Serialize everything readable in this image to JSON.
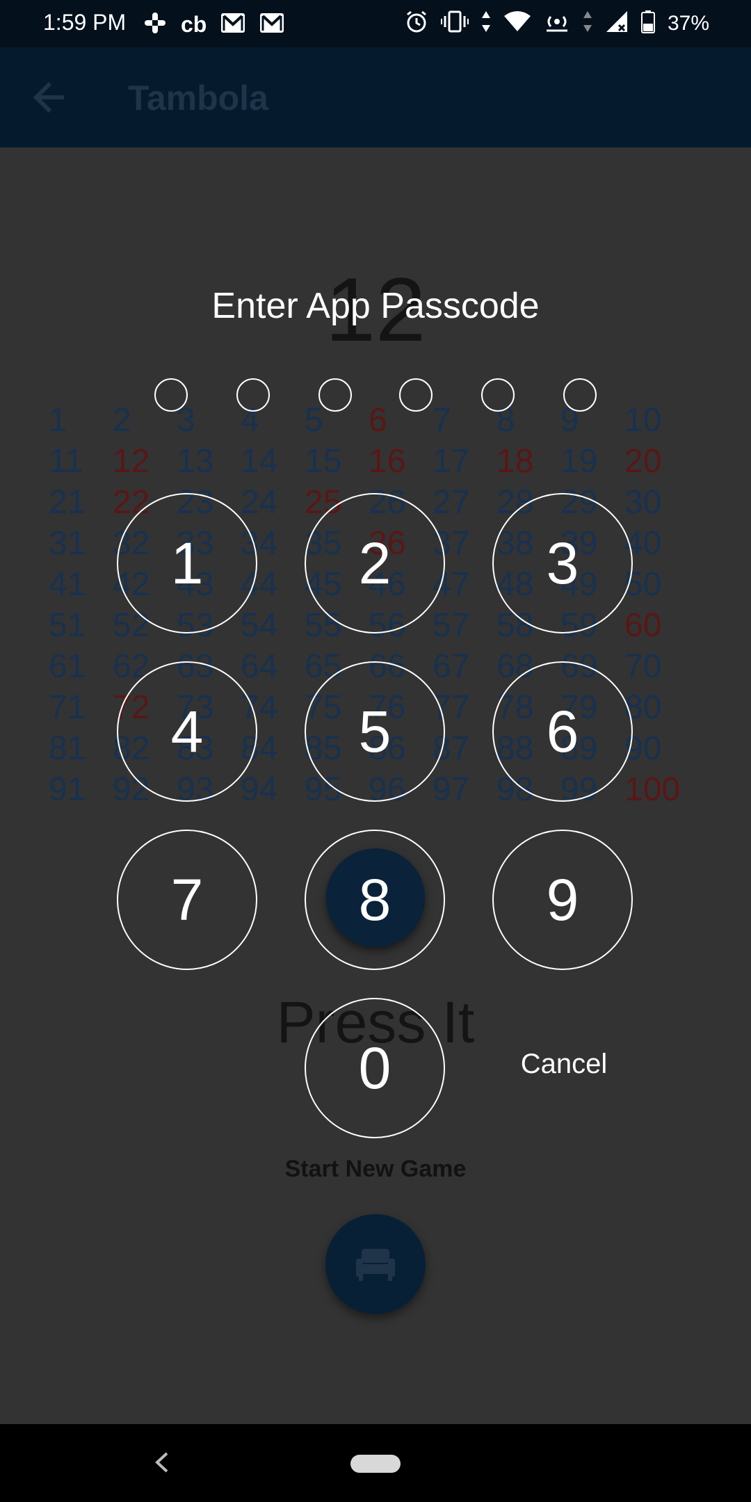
{
  "status_bar": {
    "time": "1:59 PM",
    "battery_text": "37%",
    "left_icons": [
      "slack-icon",
      "cb-icon",
      "gmail-icon",
      "gmail-icon"
    ],
    "cb_text": "cb",
    "right_icons": [
      "alarm-icon",
      "vibrate-icon",
      "wifi-icon",
      "hotspot-icon",
      "signal-icon",
      "battery-icon"
    ]
  },
  "app_bar": {
    "back_icon": "back-arrow-icon",
    "title": "Tambola"
  },
  "game": {
    "current_number": "12",
    "board_numbers": [
      "1",
      "2",
      "3",
      "4",
      "5",
      "6",
      "7",
      "8",
      "9",
      "10",
      "11",
      "12",
      "13",
      "14",
      "15",
      "16",
      "17",
      "18",
      "19",
      "20",
      "21",
      "22",
      "23",
      "24",
      "25",
      "26",
      "27",
      "28",
      "29",
      "30",
      "31",
      "32",
      "33",
      "34",
      "35",
      "36",
      "37",
      "38",
      "39",
      "40",
      "41",
      "42",
      "43",
      "44",
      "45",
      "46",
      "47",
      "48",
      "49",
      "50",
      "51",
      "52",
      "53",
      "54",
      "55",
      "56",
      "57",
      "58",
      "59",
      "60",
      "61",
      "62",
      "63",
      "64",
      "65",
      "66",
      "67",
      "68",
      "69",
      "70",
      "71",
      "72",
      "73",
      "74",
      "75",
      "76",
      "77",
      "78",
      "79",
      "80",
      "81",
      "82",
      "83",
      "84",
      "85",
      "86",
      "87",
      "88",
      "89",
      "90",
      "91",
      "92",
      "93",
      "94",
      "95",
      "96",
      "97",
      "98",
      "99",
      "100"
    ],
    "called_numbers": [
      "6",
      "12",
      "16",
      "18",
      "20",
      "22",
      "25",
      "36",
      "60",
      "72",
      "100"
    ],
    "press_label": "Press It",
    "start_new_game_label": "Start New Game",
    "start_icon": "sofa-icon"
  },
  "passcode_dialog": {
    "title": "Enter App Passcode",
    "dot_count": 6,
    "digits_entered": 0,
    "keys": [
      "1",
      "2",
      "3",
      "4",
      "5",
      "6",
      "7",
      "8",
      "9",
      "0"
    ],
    "pressed_key": "8",
    "cancel_label": "Cancel"
  },
  "nav_bar": {
    "back_icon": "nav-back-icon",
    "home_icon": "nav-home-pill-icon"
  },
  "colors": {
    "status_bar_bg": "#04101c",
    "app_bar_bg": "#061a2e",
    "overlay_bg": "#333333",
    "board_number": "#173150",
    "board_called": "#5a1616",
    "accent": "#0a223a"
  }
}
